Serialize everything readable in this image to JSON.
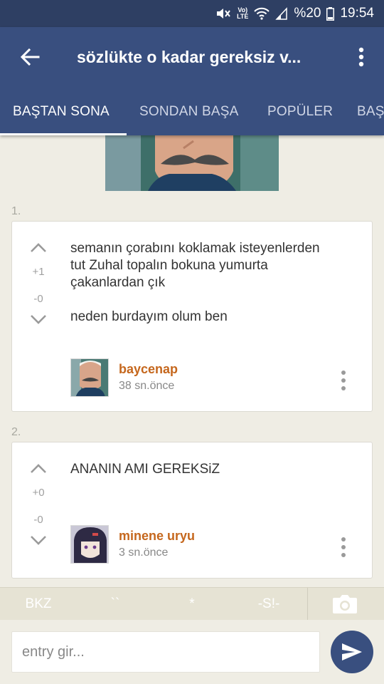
{
  "status_bar": {
    "battery_text": "%20",
    "time": "19:54",
    "volte_line1": "Vo)",
    "volte_line2": "LTE"
  },
  "app_bar": {
    "title": "sözlükte o kadar gereksiz v...",
    "tabs": [
      {
        "label": "BAŞTAN SONA",
        "active": true
      },
      {
        "label": "SONDAN BAŞA",
        "active": false
      },
      {
        "label": "POPÜLER",
        "active": false
      },
      {
        "label": "BAŞ",
        "active": false
      }
    ]
  },
  "entries": [
    {
      "number": "1.",
      "upvotes": "+1",
      "downvotes": "-0",
      "text_lines": [
        "semanın çorabını koklamak isteyenlerden",
        "tut Zuhal topalın bokuna yumurta",
        "çakanlardan çık",
        "neden burdayım olum ben"
      ],
      "author": "baycenap",
      "time": "38 sn.önce"
    },
    {
      "number": "2.",
      "upvotes": "+0",
      "downvotes": "-0",
      "text_lines": [
        "ANANIN AMI GEREKSiZ"
      ],
      "author": "minene uryu",
      "time": "3 sn.önce"
    }
  ],
  "format_bar": {
    "bkz": "BKZ",
    "backticks": "``",
    "star": "*",
    "spoiler": "-S!-"
  },
  "input": {
    "placeholder": "entry gir..."
  },
  "colors": {
    "status_bar": "#2e3f63",
    "app_bar": "#394f7f",
    "author": "#c5671d",
    "background": "#efede4"
  }
}
